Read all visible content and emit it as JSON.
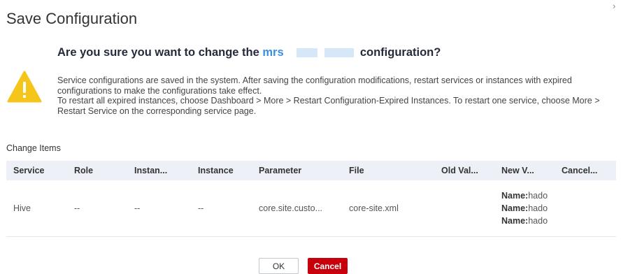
{
  "dialog": {
    "title": "Save Configuration",
    "close_glyph": "›",
    "icon": "warning-triangle-icon",
    "question_prefix": "Are you sure you want to change the ",
    "service_name": "mrs",
    "question_suffix": " configuration?",
    "description": [
      "Service configurations are saved in the system. After saving the configuration modifications, restart services or instances with expired configurations to make the configurations take effect.",
      "To restart all expired instances, choose Dashboard > More > Restart Configuration-Expired Instances. To restart one service, choose More > Restart Service on the corresponding service page."
    ],
    "colors": {
      "accent": "#3b8fe0",
      "warning": "#f5c51b",
      "danger": "#c7000b"
    }
  },
  "change_items": {
    "label": "Change Items",
    "columns": [
      "Service",
      "Role",
      "Instan...",
      "Instance",
      "Parameter",
      "File",
      "Old Val...",
      "New V...",
      "Cancel..."
    ],
    "rows": [
      {
        "service": "Hive",
        "role": "--",
        "instance_group": "--",
        "instance": "--",
        "parameter": "core.site.custo...",
        "file": "core-site.xml",
        "old_value": "",
        "new_value": [
          {
            "key": "Name:",
            "value": "hado"
          },
          {
            "key": "Name:",
            "value": "hado"
          },
          {
            "key": "Name:",
            "value": "hado"
          }
        ],
        "cancel": ""
      }
    ]
  },
  "buttons": {
    "ok": "OK",
    "cancel": "Cancel"
  }
}
